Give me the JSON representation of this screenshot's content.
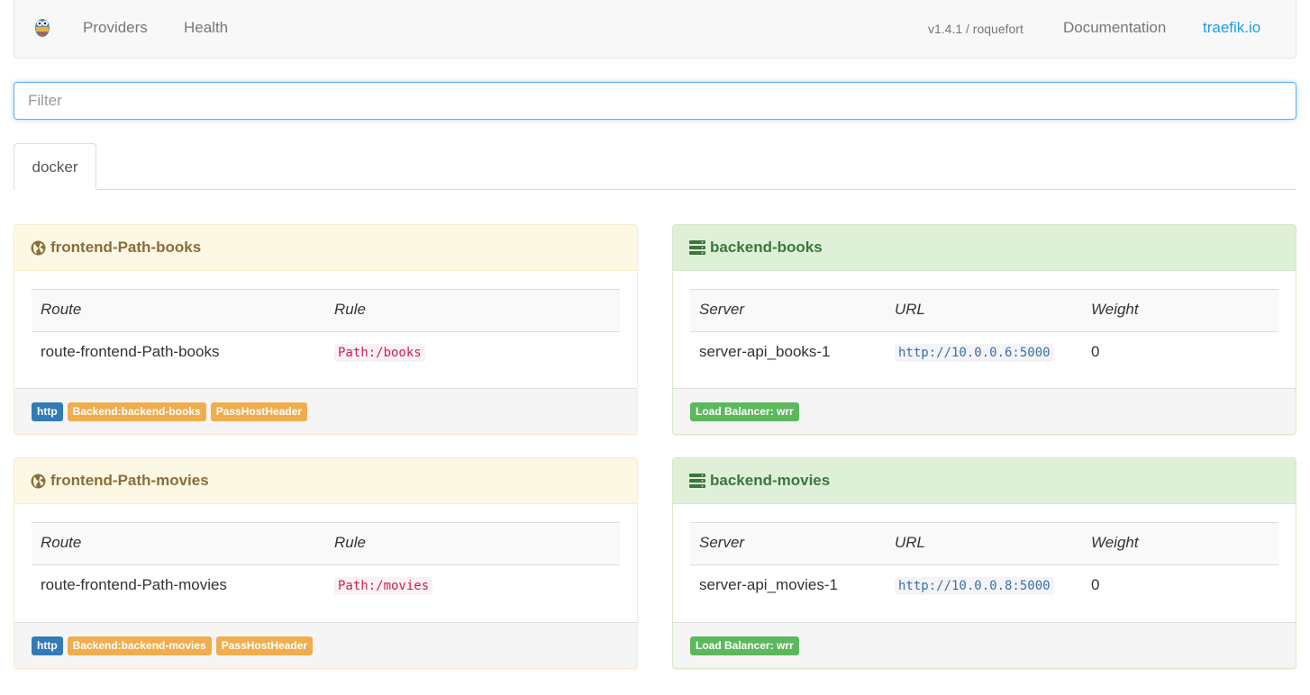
{
  "nav": {
    "providers": "Providers",
    "health": "Health",
    "version": "v1.4.1 / roquefort",
    "documentation": "Documentation",
    "site": "traefik.io"
  },
  "filter": {
    "placeholder": "Filter",
    "value": ""
  },
  "tabs": [
    {
      "label": "docker"
    }
  ],
  "frontends": [
    {
      "name": "frontend-Path-books",
      "col_route": "Route",
      "col_rule": "Rule",
      "route": "route-frontend-Path-books",
      "rule": "Path:/books",
      "labels": [
        "http",
        "Backend:backend-books",
        "PassHostHeader"
      ]
    },
    {
      "name": "frontend-Path-movies",
      "col_route": "Route",
      "col_rule": "Rule",
      "route": "route-frontend-Path-movies",
      "rule": "Path:/movies",
      "labels": [
        "http",
        "Backend:backend-movies",
        "PassHostHeader"
      ]
    }
  ],
  "backends": [
    {
      "name": "backend-books",
      "col_server": "Server",
      "col_url": "URL",
      "col_weight": "Weight",
      "server": "server-api_books-1",
      "url": "http://10.0.0.6:5000",
      "weight": "0",
      "lb": "Load Balancer: wrr"
    },
    {
      "name": "backend-movies",
      "col_server": "Server",
      "col_url": "URL",
      "col_weight": "Weight",
      "server": "server-api_movies-1",
      "url": "http://10.0.0.8:5000",
      "weight": "0",
      "lb": "Load Balancer: wrr"
    }
  ],
  "colors": {
    "frontend_heading_bg": "#fcf8e3",
    "frontend_heading_text": "#8a6d3b",
    "backend_heading_bg": "#dff0d8",
    "backend_heading_text": "#3c763d",
    "label_primary": "#337ab7",
    "label_warning": "#f0ad4e",
    "label_success": "#5cb85c",
    "link": "#1ca0e0"
  },
  "icons": {
    "logo": "traefik-gopher-logo",
    "frontend": "globe-icon",
    "backend": "server-stack-icon"
  }
}
